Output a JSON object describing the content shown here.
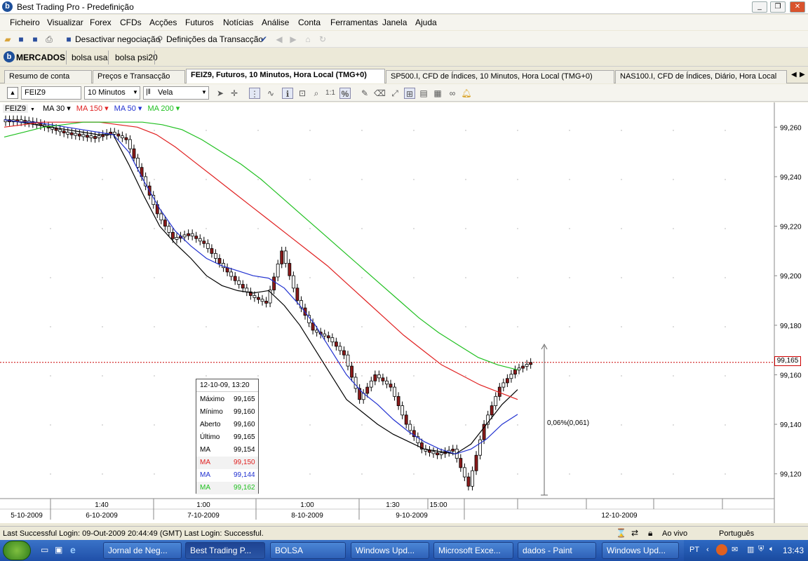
{
  "window": {
    "title": "Best Trading Pro - Predefinição",
    "controls": [
      "_",
      "❐",
      "✕"
    ]
  },
  "menu": [
    "Ficheiro",
    "Visualizar",
    "Forex",
    "CFDs",
    "Acções",
    "Futuros",
    "Notícias",
    "Análise",
    "Conta",
    "Ferramentas",
    "Janela",
    "Ajuda"
  ],
  "toolbar": {
    "deactivate_label": "Desactivar negociação",
    "settings_label": "Definições da Transacção"
  },
  "markets": {
    "main_label": "MERCADOS",
    "tabs": [
      "bolsa usa",
      "bolsa psi20"
    ]
  },
  "tabs": [
    "Resumo de conta",
    "Preços e Transacção",
    "FEIZ9, Futuros, 10 Minutos, Hora Local (TMG+0)",
    "SP500.I, CFD de Índices, 10 Minutos, Hora Local (TMG+0)",
    "NAS100.I, CFD de Índices, Diário, Hora Local"
  ],
  "chart_tools": {
    "symbol": "FEIZ9",
    "interval": "10 Minutos",
    "chart_type": "Vela"
  },
  "legend": {
    "symbol": "FEIZ9",
    "items": [
      {
        "label": "MA 30",
        "color": "#000000"
      },
      {
        "label": "MA 150",
        "color": "#e02020"
      },
      {
        "label": "MA 50",
        "color": "#2030d0"
      },
      {
        "label": "MA 200",
        "color": "#20c020"
      }
    ]
  },
  "price_marker": "99,165",
  "measure_label": "0,06%(0,061)",
  "infobox": {
    "header": "12-10-09, 13:20",
    "rows": [
      {
        "label": "Máximo",
        "value": "99,165",
        "color": "#000000"
      },
      {
        "label": "Mínimo",
        "value": "99,160",
        "color": "#000000"
      },
      {
        "label": "Aberto",
        "value": "99,160",
        "color": "#000000"
      },
      {
        "label": "Último",
        "value": "99,165",
        "color": "#000000"
      },
      {
        "label": "MA",
        "value": "99,154",
        "color": "#000000"
      },
      {
        "label": "MA",
        "value": "99,150",
        "color": "#e02020"
      },
      {
        "label": "MA",
        "value": "99,144",
        "color": "#2030d0"
      },
      {
        "label": "MA",
        "value": "99,162",
        "color": "#20c020"
      }
    ]
  },
  "chart_data": {
    "type": "line",
    "ylim": [
      99.11,
      99.27
    ],
    "yticks": [
      "99,260",
      "99,240",
      "99,220",
      "99,200",
      "99,180",
      "99,160",
      "99,140",
      "99,120"
    ],
    "time_labels": [
      "1:40",
      "1:00",
      "1:00",
      "1:30",
      "15:00"
    ],
    "date_labels": [
      "5-10-2009",
      "6-10-2009",
      "7-10-2009",
      "8-10-2009",
      "9-10-2009",
      "12-10-2009"
    ],
    "current_price": 99.165,
    "series": [
      {
        "name": "FEIZ9",
        "color": "#000000",
        "values": [
          99.263,
          99.262,
          99.26,
          99.258,
          99.257,
          99.256,
          99.258,
          99.255,
          99.24,
          99.225,
          99.215,
          99.217,
          99.213,
          99.205,
          99.198,
          99.192,
          99.189,
          99.21,
          99.19,
          99.178,
          99.175,
          99.168,
          99.15,
          99.16,
          99.155,
          99.14,
          99.13,
          99.128,
          99.13,
          99.115,
          99.14,
          99.155,
          99.162,
          99.165
        ]
      },
      {
        "name": "MA 30",
        "color": "#000000",
        "values": [
          99.263,
          99.262,
          99.261,
          99.26,
          99.259,
          99.258,
          99.257,
          99.257,
          99.245,
          99.232,
          99.22,
          99.213,
          99.207,
          99.2,
          99.196,
          99.194,
          99.193,
          99.194,
          99.188,
          99.18,
          99.17,
          99.16,
          99.15,
          99.145,
          99.14,
          99.136,
          99.133,
          99.13,
          99.129,
          99.128,
          99.132,
          99.14,
          99.148,
          99.154
        ]
      },
      {
        "name": "MA 50",
        "color": "#2030d0",
        "values": [
          99.263,
          99.262,
          99.262,
          99.261,
          99.26,
          99.259,
          99.258,
          99.257,
          99.25,
          99.238,
          99.227,
          99.218,
          99.212,
          99.207,
          99.204,
          99.202,
          99.2,
          99.199,
          99.195,
          99.188,
          99.18,
          99.17,
          99.16,
          99.153,
          99.148,
          99.142,
          99.137,
          99.133,
          99.13,
          99.128,
          99.13,
          99.134,
          99.14,
          99.144
        ]
      },
      {
        "name": "MA 150",
        "color": "#e02020",
        "values": [
          99.26,
          99.261,
          99.262,
          99.262,
          99.262,
          99.262,
          99.261,
          99.26,
          99.257,
          99.252,
          99.246,
          99.24,
          99.234,
          99.228,
          99.222,
          99.216,
          99.21,
          99.204,
          99.197,
          99.19,
          99.183,
          99.176,
          99.17,
          99.164,
          99.16,
          99.156,
          99.153,
          99.15
        ]
      },
      {
        "name": "MA 200",
        "color": "#20c020",
        "values": [
          99.256,
          99.258,
          99.26,
          99.261,
          99.262,
          99.262,
          99.262,
          99.262,
          99.261,
          99.259,
          99.255,
          99.25,
          99.245,
          99.239,
          99.232,
          99.225,
          99.218,
          99.211,
          99.204,
          99.197,
          99.19,
          99.183,
          99.177,
          99.172,
          99.167,
          99.164,
          99.162
        ]
      }
    ]
  },
  "status": {
    "login_text": "Last Successful Login: 09-Out-2009 20:44:49 (GMT)  Last Login: Successful.",
    "live": "Ao vivo",
    "language": "Português"
  },
  "taskbar": {
    "items": [
      "Jornal de Neg...",
      "Best Trading P...",
      "BOLSA",
      "Windows Upd...",
      "Microsoft Exce...",
      "dados - Paint",
      "Windows Upd..."
    ],
    "tray_lang": "PT",
    "clock": "13:43"
  }
}
